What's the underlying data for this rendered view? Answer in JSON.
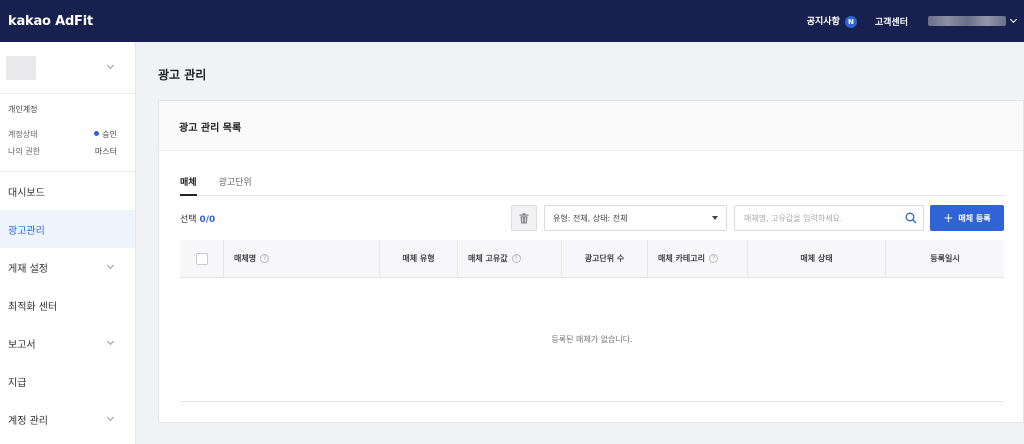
{
  "header": {
    "logo": "kakao AdFit",
    "notice": "공지사항",
    "notice_badge": "N",
    "support": "고객센터"
  },
  "sidebar": {
    "account_type": "개인계정",
    "status_label": "계정상태",
    "status_value": "승인",
    "role_label": "나의 권한",
    "role_value": "마스터",
    "items": [
      {
        "label": "대시보드"
      },
      {
        "label": "광고관리"
      },
      {
        "label": "게재 설정"
      },
      {
        "label": "최적화 센터"
      },
      {
        "label": "보고서"
      },
      {
        "label": "지급"
      },
      {
        "label": "계정 관리"
      }
    ]
  },
  "main": {
    "page_title": "광고 관리",
    "card_title": "광고 관리 목록",
    "tabs": [
      {
        "label": "매체"
      },
      {
        "label": "광고단위"
      }
    ],
    "selection_label": "선택",
    "selection_count": "0/0",
    "filter_value": "유형: 전체, 상태: 전체",
    "search_placeholder": "매체명, 고유값을 입력하세요.",
    "add_button": "매체 등록",
    "columns": [
      "매체명",
      "매체 유형",
      "매체 고유값",
      "광고단위 수",
      "매체 카테고리",
      "매체 상태",
      "등록일시"
    ],
    "empty_message": "등록된 매체가 없습니다."
  },
  "colors": {
    "header_bg": "#182050",
    "accent": "#2f63d6"
  }
}
